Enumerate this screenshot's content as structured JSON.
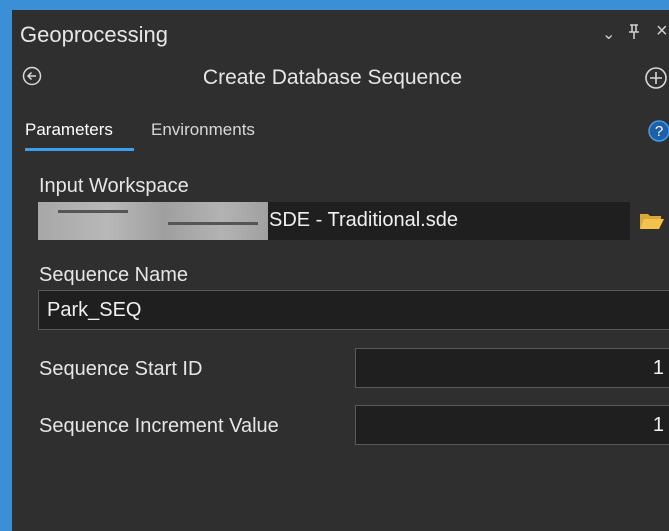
{
  "pane": {
    "title": "Geoprocessing",
    "controls": {
      "dropdown": "⌄",
      "pin": "🖈",
      "close": "×"
    }
  },
  "tool": {
    "title": "Create Database Sequence",
    "icons": {
      "back": "back-arrow-circle-icon",
      "add": "plus-circle-icon"
    }
  },
  "tabs": [
    {
      "label": "Parameters",
      "active": true
    },
    {
      "label": "Environments",
      "active": false
    }
  ],
  "help_icon": "question-circle-icon",
  "parameters": {
    "input_workspace": {
      "label": "Input Workspace",
      "value": "SDE - Traditional.sde"
    },
    "sequence_name": {
      "label": "Sequence Name",
      "value": "Park_SEQ"
    },
    "start_id": {
      "label": "Sequence Start ID",
      "value": "1"
    },
    "increment": {
      "label": "Sequence Increment Value",
      "value": "1"
    }
  },
  "colors": {
    "background": "#2f2f2f",
    "field": "#1f1f1f",
    "accent": "#3b9ff0",
    "folder": "#f2c14e",
    "frame": "#3a8fd6"
  }
}
